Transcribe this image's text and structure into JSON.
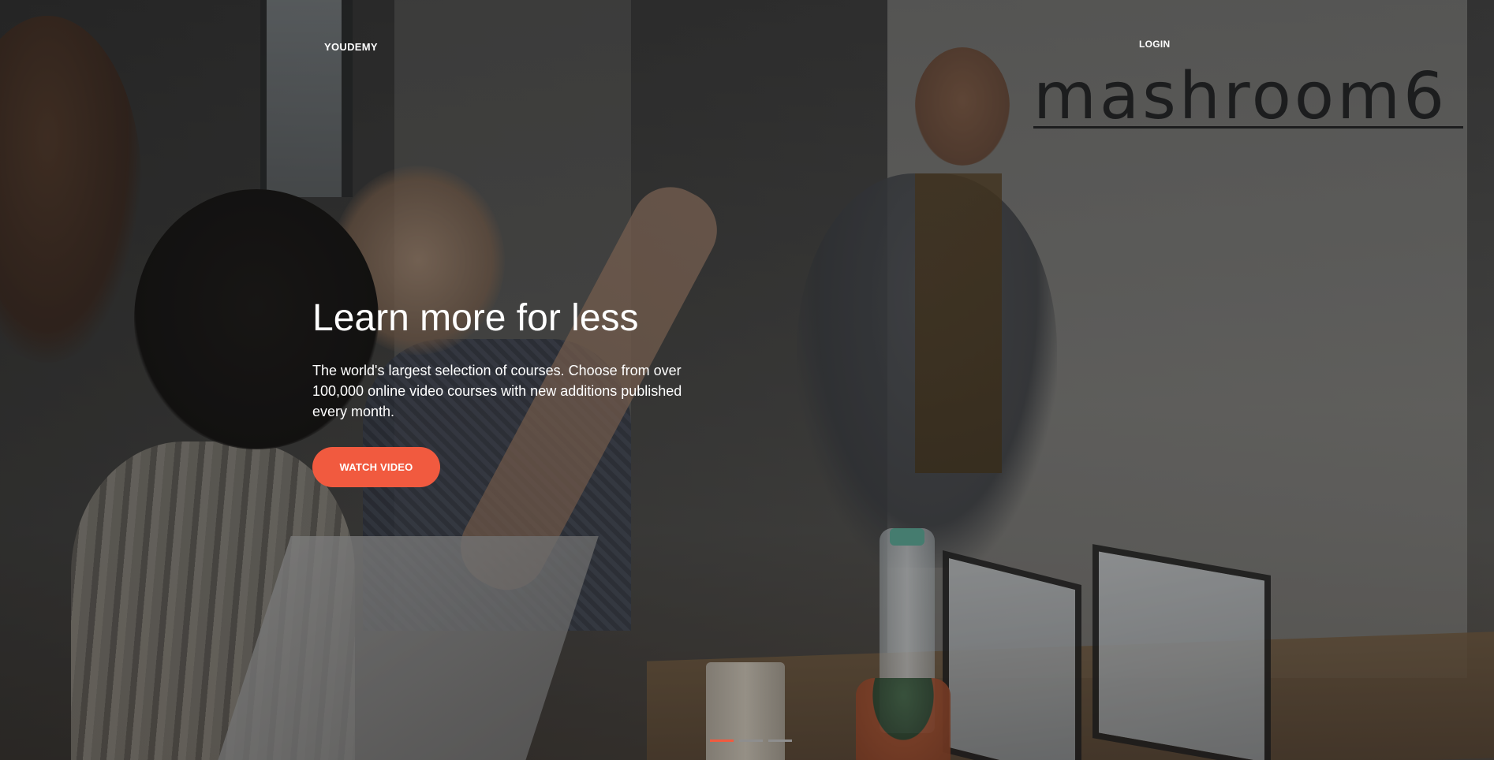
{
  "header": {
    "brand": "YOUDEMY",
    "login_label": "LOGIN"
  },
  "hero": {
    "title": "Learn more for less",
    "subtitle": "The world's largest selection of courses. Choose from over 100,000 online video courses with new additions published every month.",
    "cta_label": "WATCH VIDEO",
    "wall_sign": "mashroom6"
  },
  "carousel": {
    "slides": 3,
    "active_index": 0
  },
  "colors": {
    "accent": "#f15a3f",
    "text": "#ffffff",
    "indicator_inactive": "#8e8e8e"
  },
  "icons": []
}
